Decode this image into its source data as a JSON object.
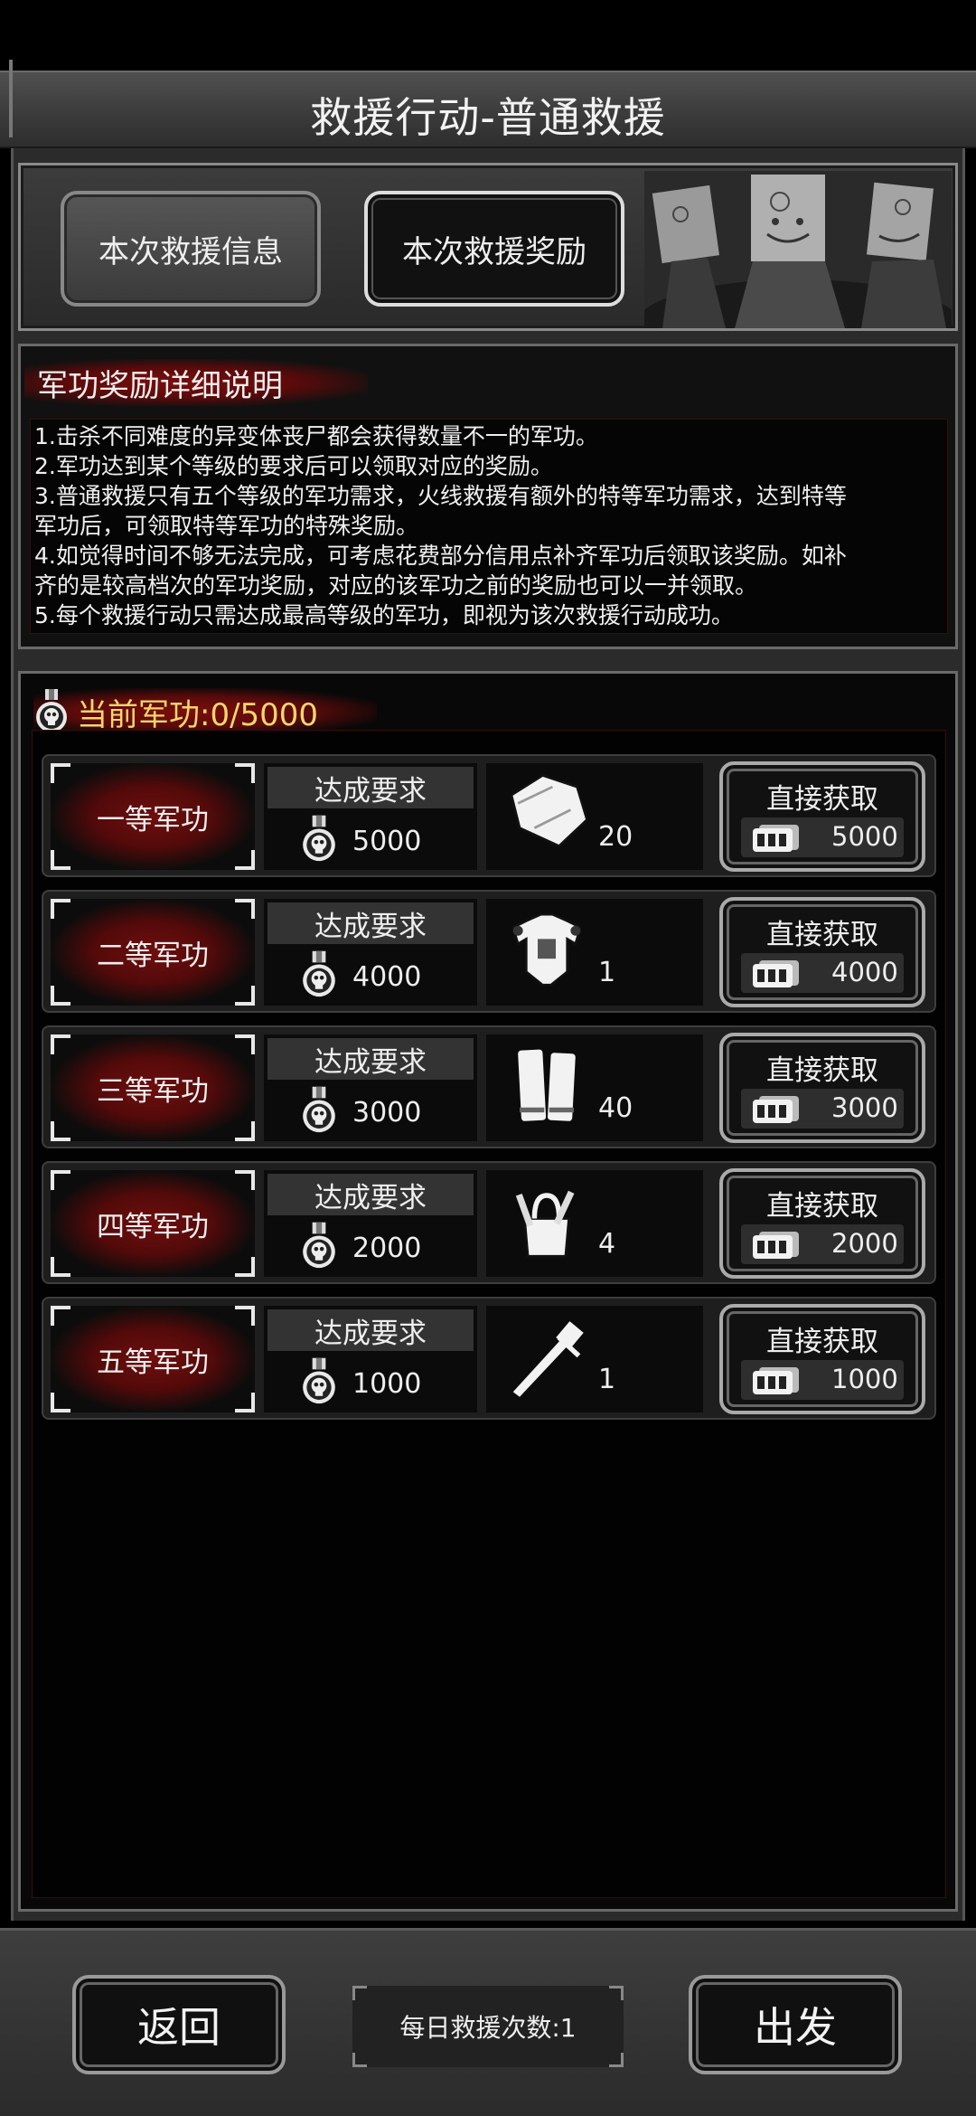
{
  "header": {
    "title": "救援行动-普通救援"
  },
  "tabs": [
    {
      "label": "本次救援信息",
      "active": false
    },
    {
      "label": "本次救援奖励",
      "active": true
    }
  ],
  "description": {
    "heading": "军功奖励详细说明",
    "lines": [
      "1.击杀不同难度的异变体丧尸都会获得数量不一的军功。",
      "2.军功达到某个等级的要求后可以领取对应的奖励。",
      "3.普通救援只有五个等级的军功需求，火线救援有额外的特等军功需求，达到特等",
      "军功后，可领取特等军功的特殊奖励。",
      "4.如觉得时间不够无法完成，可考虑花费部分信用点补齐军功后领取该奖励。如补",
      "齐的是较高档次的军功奖励，对应的该军功之前的奖励也可以一并领取。",
      "5.每个救援行动只需达成最高等级的军功，即视为该次救援行动成功。"
    ]
  },
  "merit": {
    "current_label": "当前军功:0/5000"
  },
  "tiers": [
    {
      "name": "一等军功",
      "req_label": "达成要求",
      "requirement": "5000",
      "item_icon": "cloth-icon",
      "item_count": "20",
      "buy_label": "直接获取",
      "price": "5000"
    },
    {
      "name": "二等军功",
      "req_label": "达成要求",
      "requirement": "4000",
      "item_icon": "armor-vest-icon",
      "item_count": "1",
      "buy_label": "直接获取",
      "price": "4000"
    },
    {
      "name": "三等军功",
      "req_label": "达成要求",
      "requirement": "3000",
      "item_icon": "bandage-icon",
      "item_count": "40",
      "buy_label": "直接获取",
      "price": "3000"
    },
    {
      "name": "四等军功",
      "req_label": "达成要求",
      "requirement": "2000",
      "item_icon": "toolbox-icon",
      "item_count": "4",
      "buy_label": "直接获取",
      "price": "2000"
    },
    {
      "name": "五等军功",
      "req_label": "达成要求",
      "requirement": "1000",
      "item_icon": "sword-icon",
      "item_count": "1",
      "buy_label": "直接获取",
      "price": "1000"
    }
  ],
  "footer": {
    "back_label": "返回",
    "daily_label": "每日救援次数:1",
    "go_label": "出发"
  },
  "colors": {
    "accent_red": "#6e0e0e",
    "merit_gold": "#f5d66a",
    "panel_bg": "#2b2b2b"
  }
}
